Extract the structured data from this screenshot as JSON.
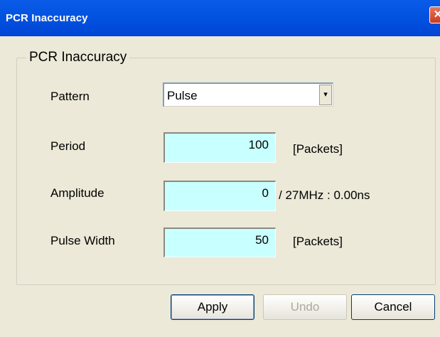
{
  "window": {
    "title": "PCR Inaccuracy",
    "close_glyph": "✕"
  },
  "group": {
    "legend": "PCR Inaccuracy"
  },
  "fields": {
    "pattern": {
      "label": "Pattern",
      "value": "Pulse",
      "arrow": "▾"
    },
    "period": {
      "label": "Period",
      "value": "100",
      "unit": "[Packets]"
    },
    "amplitude": {
      "label": "Amplitude",
      "value": "0",
      "unit": "/ 27MHz :  0.00ns"
    },
    "pulse_width": {
      "label": "Pulse Width",
      "value": "50",
      "unit": "[Packets]"
    }
  },
  "buttons": {
    "apply": "Apply",
    "undo": "Undo",
    "cancel": "Cancel"
  },
  "colors": {
    "title_bar": "#0353E0",
    "field_background": "#C8FFFF",
    "dialog_background": "#ECE9D8"
  }
}
